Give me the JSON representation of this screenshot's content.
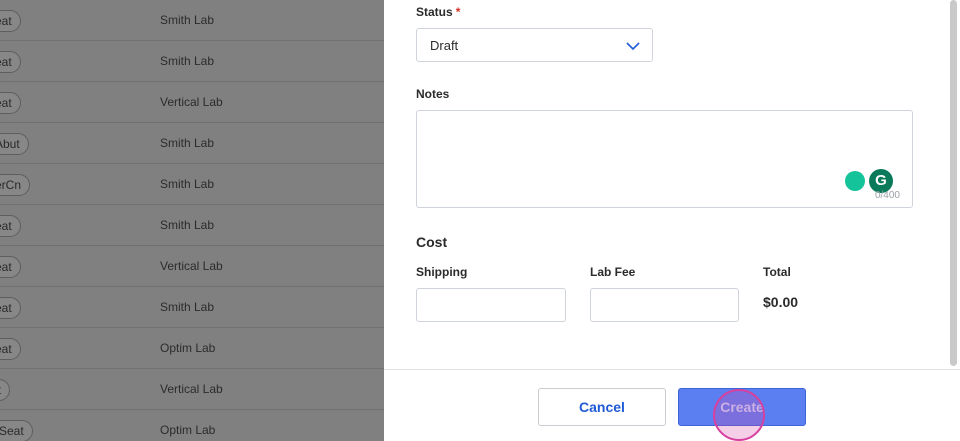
{
  "background_table": {
    "rows": [
      {
        "chip": "eat",
        "lab": "Smith Lab"
      },
      {
        "chip": "eat",
        "lab": "Smith Lab"
      },
      {
        "chip": "eat",
        "lab": "Vertical Lab"
      },
      {
        "chip": "Abut",
        "lab": "Smith Lab"
      },
      {
        "chip": "erCn",
        "lab": "Smith Lab"
      },
      {
        "chip": "eat",
        "lab": "Smith Lab"
      },
      {
        "chip": "eat",
        "lab": "Vertical Lab"
      },
      {
        "chip": "eat",
        "lab": "Smith Lab"
      },
      {
        "chip": "eat",
        "lab": "Optim Lab"
      },
      {
        "chip": "at",
        "lab": "Vertical Lab"
      },
      {
        "chip": "Seat",
        "lab": "Optim Lab"
      }
    ]
  },
  "form": {
    "status": {
      "label": "Status",
      "required_mark": "*",
      "value": "Draft",
      "icon": "chevron-down-icon"
    },
    "notes": {
      "label": "Notes",
      "value": "",
      "counter": "0/400"
    },
    "cost": {
      "title": "Cost",
      "shipping_label": "Shipping",
      "shipping_value": "",
      "lab_fee_label": "Lab Fee",
      "lab_fee_value": "",
      "total_label": "Total",
      "total_value": "$0.00"
    }
  },
  "footer": {
    "cancel_label": "Cancel",
    "create_label": "Create"
  },
  "colors": {
    "accent": "#1f5bd6",
    "create_button": "#5b7ff0",
    "required": "#d93025",
    "grammarly": "#15c39a"
  }
}
